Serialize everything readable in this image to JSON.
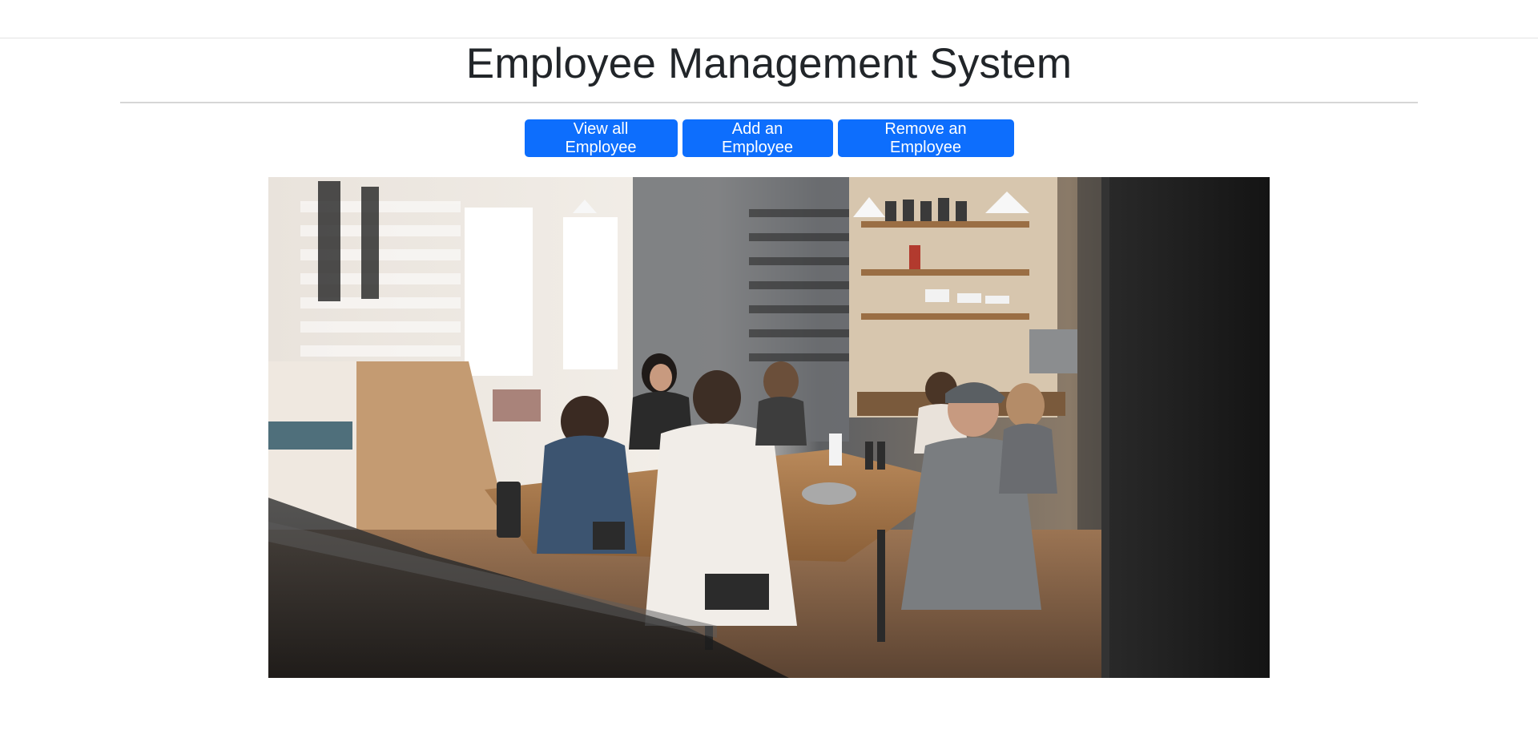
{
  "page": {
    "title": "Employee Management System"
  },
  "actions": {
    "view_all_label": "View all Employee",
    "add_label": "Add an Employee",
    "remove_label": "Remove an Employee"
  },
  "hero_image": {
    "alt": "Team meeting around a wooden table in an office kitchen"
  },
  "colors": {
    "primary": "#0d6efd",
    "text": "#212529",
    "rule": "#d6d6d6"
  }
}
